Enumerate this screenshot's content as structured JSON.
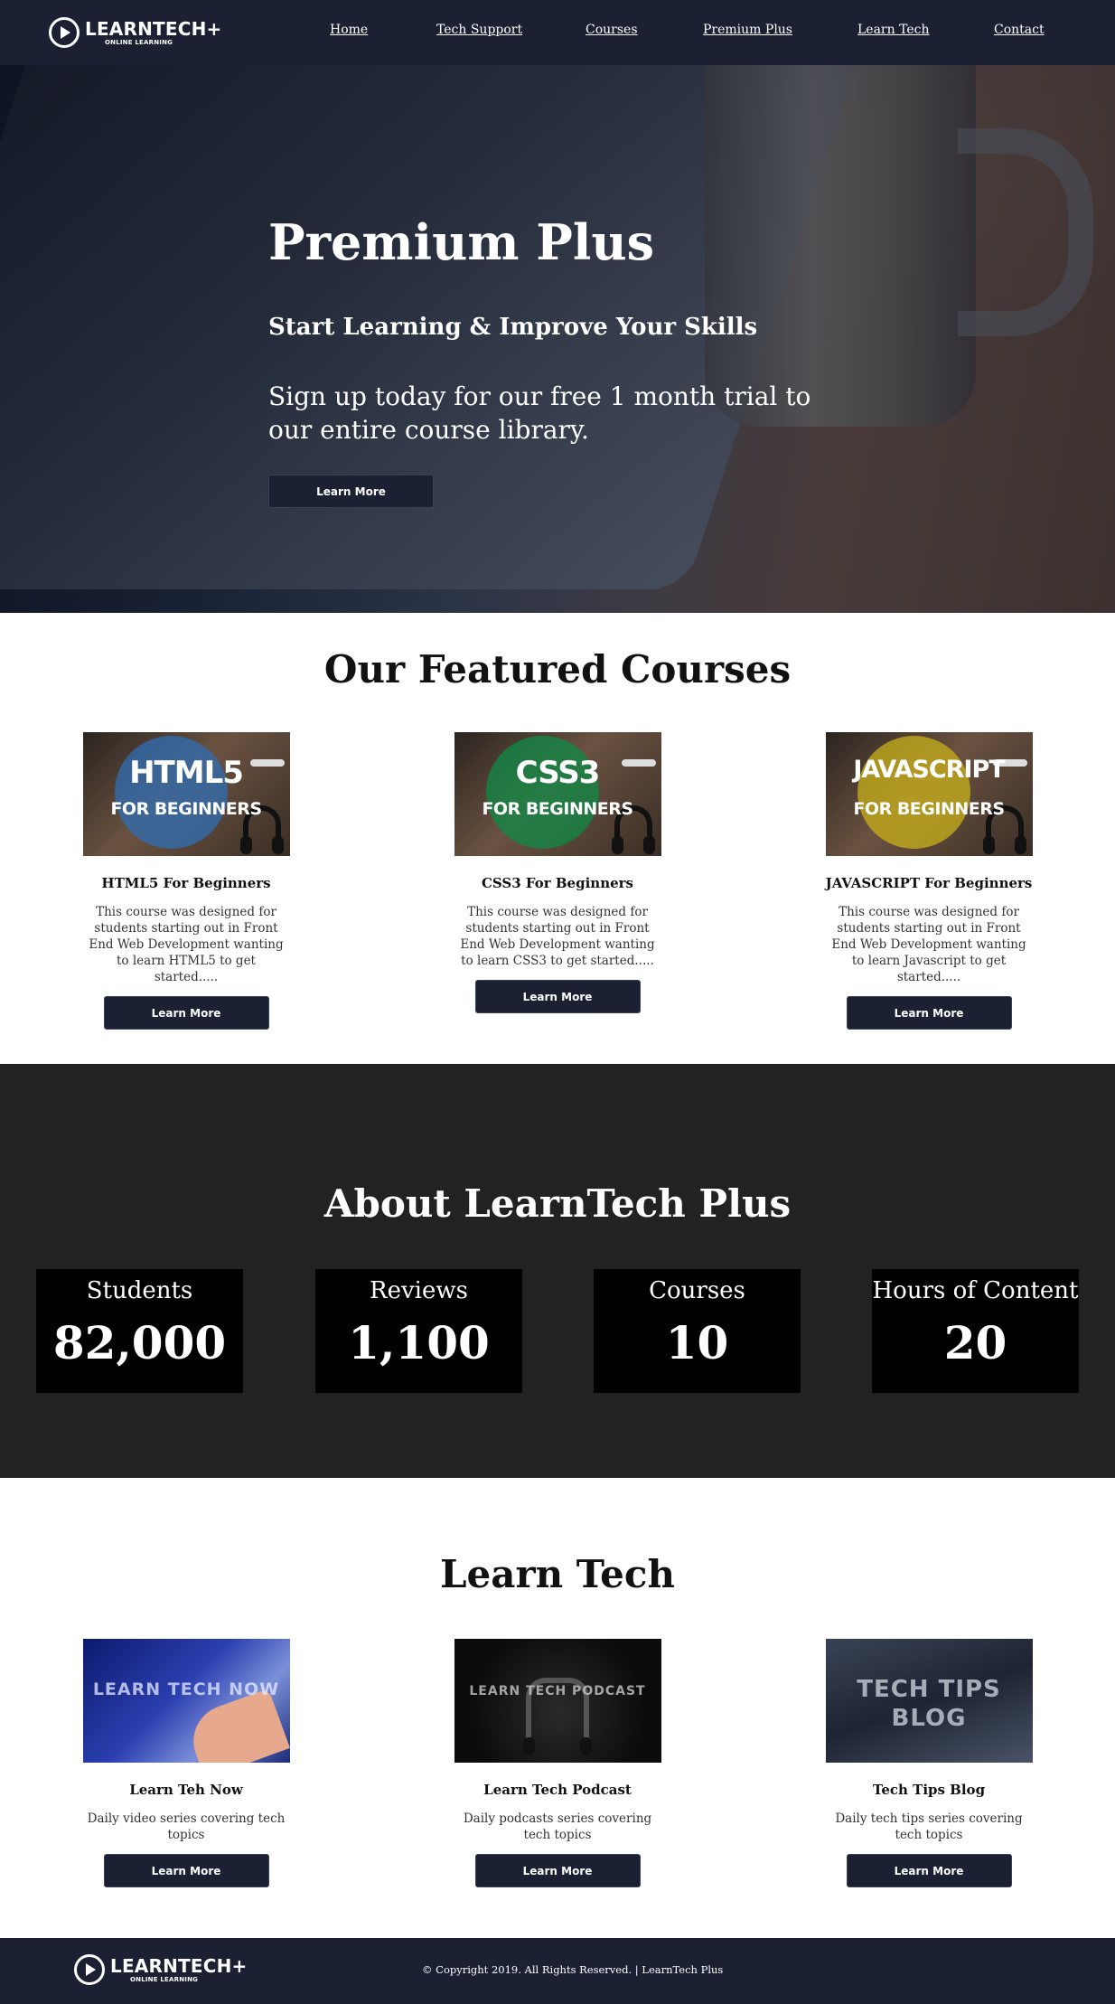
{
  "brand": {
    "name": "LEARNTECH+",
    "tagline": "ONLINE LEARNING"
  },
  "nav": {
    "items": [
      {
        "label": "Home"
      },
      {
        "label": "Tech Support"
      },
      {
        "label": "Courses"
      },
      {
        "label": "Premium Plus"
      },
      {
        "label": "Learn Tech"
      },
      {
        "label": "Contact"
      }
    ]
  },
  "hero": {
    "title": "Premium Plus",
    "subtitle": "Start Learning & Improve Your Skills",
    "text": "Sign up today for our free 1 month trial to our entire course library.",
    "button": "Learn More"
  },
  "featured": {
    "title": "Our Featured Courses",
    "courses": [
      {
        "thumb_line1": "HTML5",
        "thumb_line2": "FOR BEGINNERS",
        "thumb_color": "#2f6db3",
        "title": "HTML5 For Beginners",
        "desc": "This course was designed for students starting out in Front End Web Development wanting to learn HTML5 to get started.....",
        "button": "Learn More"
      },
      {
        "thumb_line1": "CSS3",
        "thumb_line2": "FOR BEGINNERS",
        "thumb_color": "#0f8a45",
        "title": "CSS3 For Beginners",
        "desc": "This course was designed for students starting out in Front End Web Development wanting to learn CSS3 to get started.....",
        "button": "Learn More"
      },
      {
        "thumb_line1": "JAVASCRIPT",
        "thumb_line2": "FOR BEGINNERS",
        "thumb_color": "#c8b01a",
        "title": "JAVASCRIPT For Beginners",
        "desc": "This course was designed for students starting out in Front End Web Development wanting to learn Javascript to get started.....",
        "button": "Learn More"
      }
    ]
  },
  "about": {
    "title": "About LearnTech Plus",
    "stats": [
      {
        "label": "Students",
        "value": "82,000"
      },
      {
        "label": "Reviews",
        "value": "1,100"
      },
      {
        "label": "Courses",
        "value": "10"
      },
      {
        "label": "Hours of Content",
        "value": "20"
      }
    ]
  },
  "learn": {
    "title": "Learn Tech",
    "items": [
      {
        "thumb_text": "LEARN TECH NOW",
        "title": "Learn Teh Now",
        "desc": "Daily video series covering tech topics",
        "button": "Learn More"
      },
      {
        "thumb_text": "LEARN TECH PODCAST",
        "title": "Learn Tech Podcast",
        "desc": "Daily podcasts series covering tech topics",
        "button": "Learn More"
      },
      {
        "thumb_text": "TECH TIPS BLOG",
        "title": "Tech Tips Blog",
        "desc": "Daily tech tips series covering tech topics",
        "button": "Learn More"
      }
    ]
  },
  "footer": {
    "copyright": "© Copyright 2019. All Rights Reserved. | LearnTech Plus"
  },
  "colors": {
    "navy": "#1b2033",
    "dark": "#222222",
    "black": "#000000"
  }
}
